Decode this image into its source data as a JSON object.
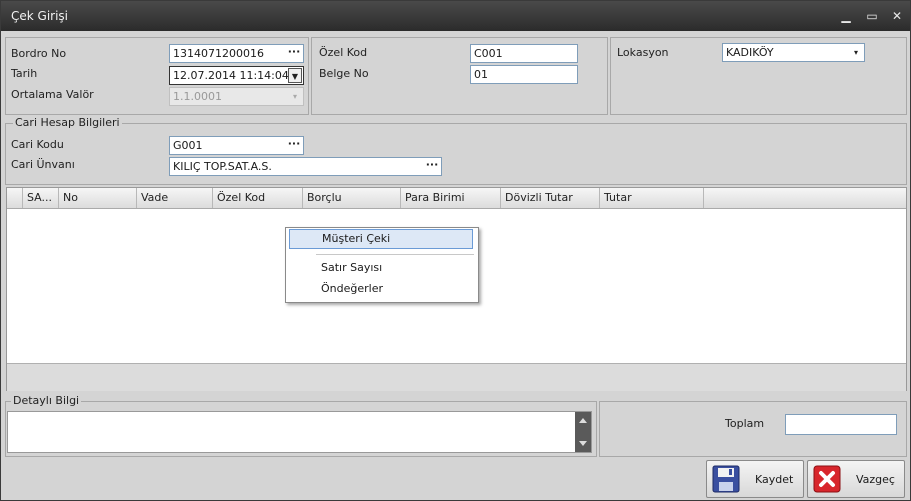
{
  "window": {
    "title": "Çek Girişi",
    "controls": {
      "minimize": "▁",
      "maximize": "▭",
      "close": "✕"
    }
  },
  "header": {
    "bordro_no_label": "Bordro No",
    "bordro_no_value": "1314071200016",
    "tarih_label": "Tarih",
    "tarih_value": "12.07.2014 11:14:04",
    "ortalama_valor_label": "Ortalama Valör",
    "ortalama_valor_value": "1.1.0001",
    "ozel_kod_label": "Özel Kod",
    "ozel_kod_value": "C001",
    "belge_no_label": "Belge No",
    "belge_no_value": "01",
    "lokasyon_label": "Lokasyon",
    "lokasyon_value": "KADIKÖY"
  },
  "cari": {
    "legend": "Cari Hesap Bilgileri",
    "cari_kodu_label": "Cari Kodu",
    "cari_kodu_value": "G001",
    "cari_unvani_label": "Cari Ünvanı",
    "cari_unvani_value": "KILIÇ TOP.SAT.A.S."
  },
  "grid": {
    "columns": [
      "SA...",
      "No",
      "Vade",
      "Özel Kod",
      "Borçlu",
      "Para Birimi",
      "Dövizli Tutar",
      "Tutar"
    ]
  },
  "context_menu": {
    "items": [
      "Müşteri Çeki",
      "Satır Sayısı",
      "Öndeğerler"
    ],
    "highlighted": "Müşteri Çeki"
  },
  "detail": {
    "legend": "Detaylı Bilgi",
    "value": ""
  },
  "totals": {
    "toplam_label": "Toplam",
    "toplam_value": ""
  },
  "buttons": {
    "kaydet": "Kaydet",
    "vazgec": "Vazgeç"
  },
  "icons": {
    "ellipsis": "···",
    "dropdown": "▼",
    "dropdown_small": "▾"
  },
  "colors": {
    "title_bar": "#2b2b2b",
    "highlight": "#dde8f6",
    "save_icon": "#3a4fa0",
    "cancel_icon": "#d8262c"
  }
}
